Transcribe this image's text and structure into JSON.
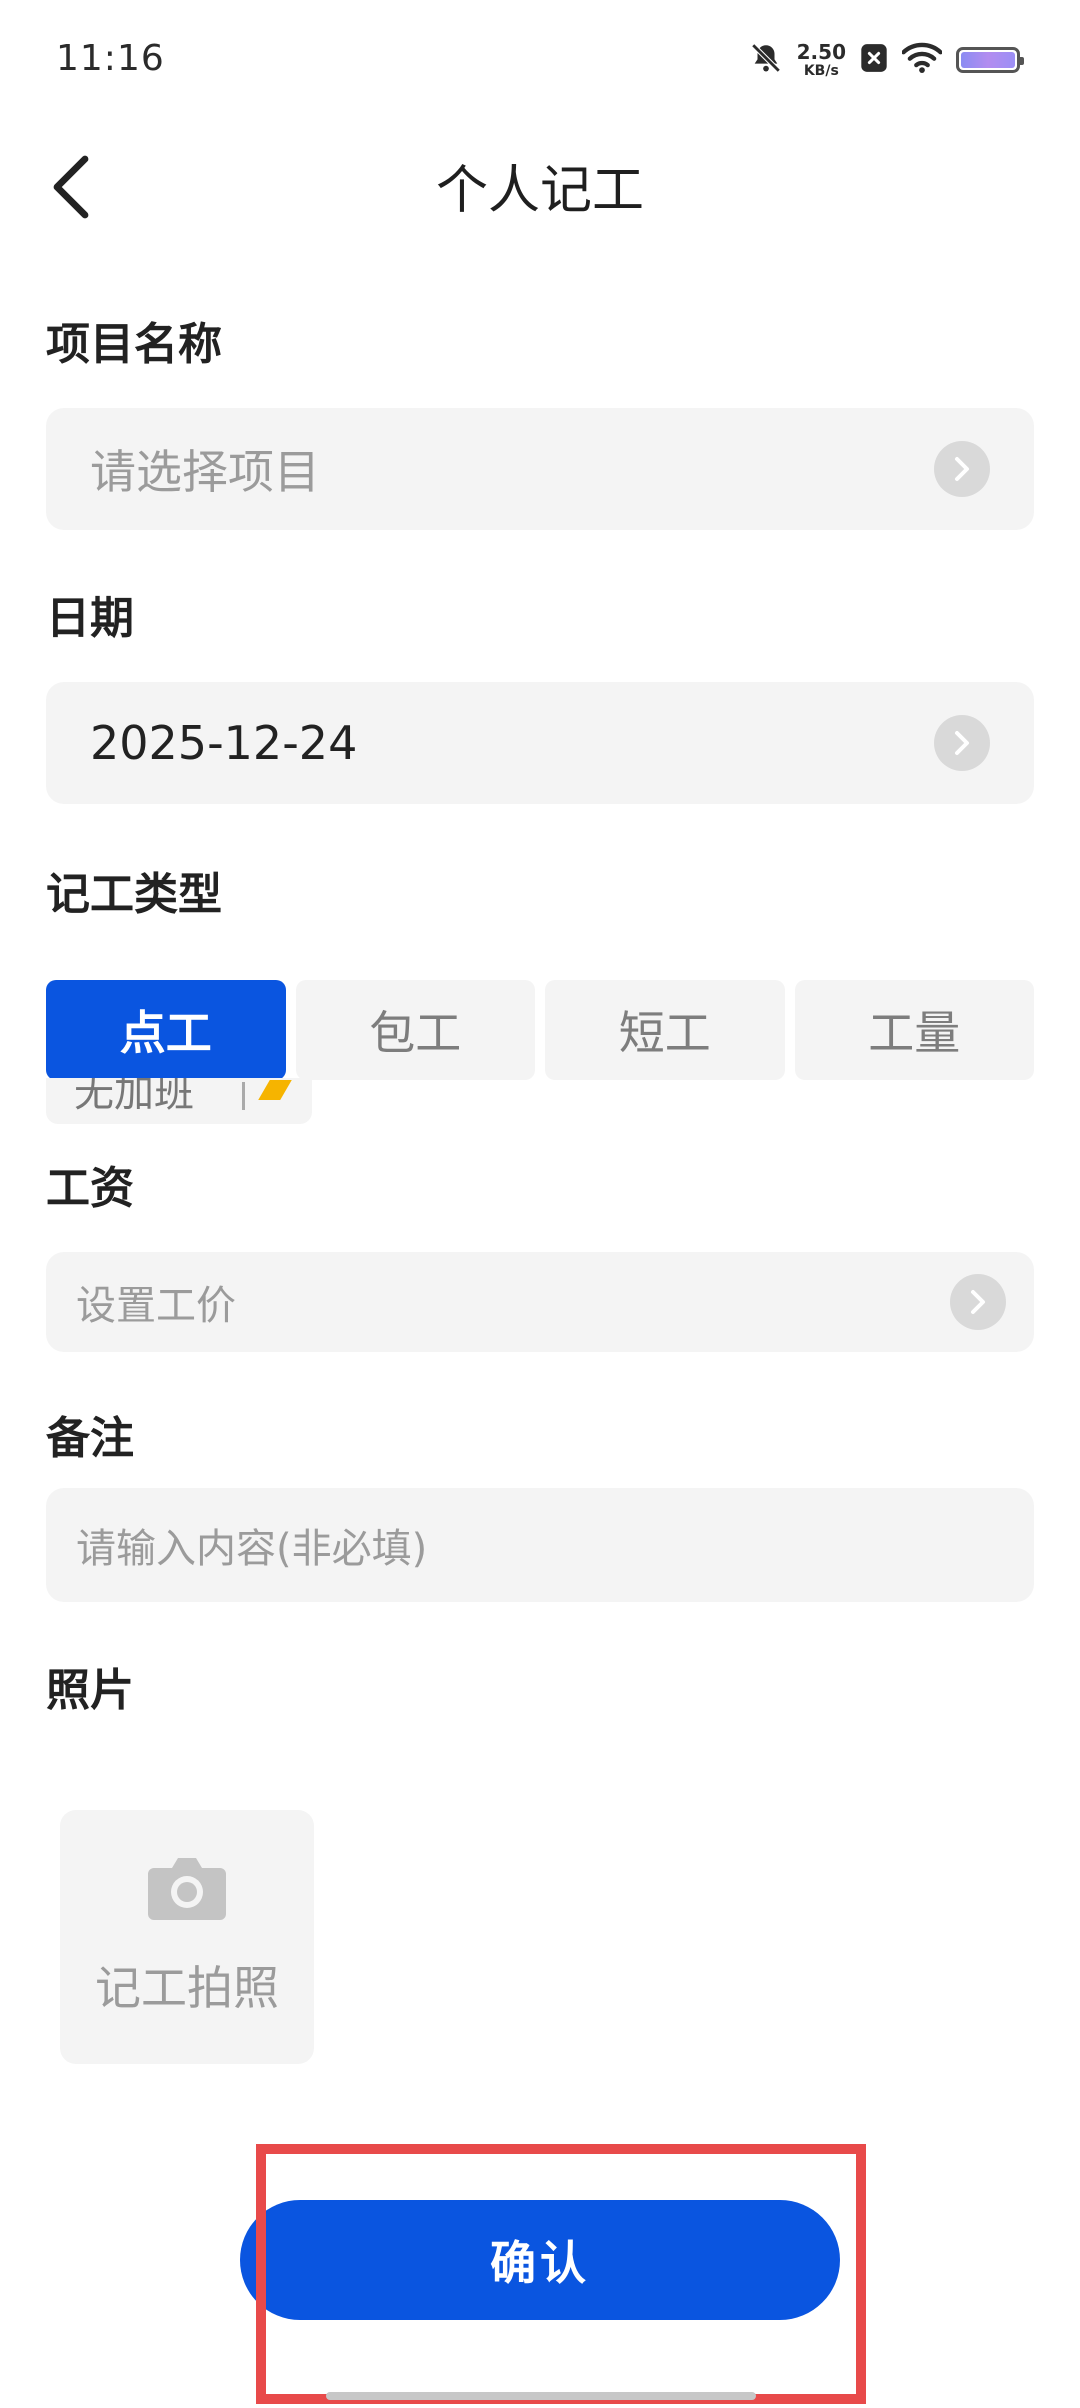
{
  "status_bar": {
    "time": "11:16",
    "speed_value": "2.50",
    "speed_unit": "KB/s",
    "icons": [
      "bell-off-icon",
      "close-badge-icon",
      "wifi-icon",
      "battery-icon"
    ]
  },
  "header": {
    "title": "个人记工",
    "back_icon": "chevron-left-icon"
  },
  "project": {
    "label": "项目名称",
    "placeholder": "请选择项目"
  },
  "date": {
    "label": "日期",
    "value": "2025-12-24"
  },
  "work_type": {
    "label": "记工类型",
    "tabs": [
      "点工",
      "包工",
      "短工",
      "工量"
    ],
    "active_index": 0,
    "overtime_chip": "无加班"
  },
  "wage": {
    "label": "工资",
    "placeholder": "设置工价"
  },
  "remark": {
    "label": "备注",
    "placeholder": "请输入内容(非必填)"
  },
  "photo": {
    "label": "照片",
    "tile_label": "记工拍照"
  },
  "confirm_label": "确认",
  "colors": {
    "primary": "#0a55e0",
    "field_bg": "#f4f4f4",
    "placeholder": "#9b9b9b",
    "highlight": "#e84a4a"
  }
}
